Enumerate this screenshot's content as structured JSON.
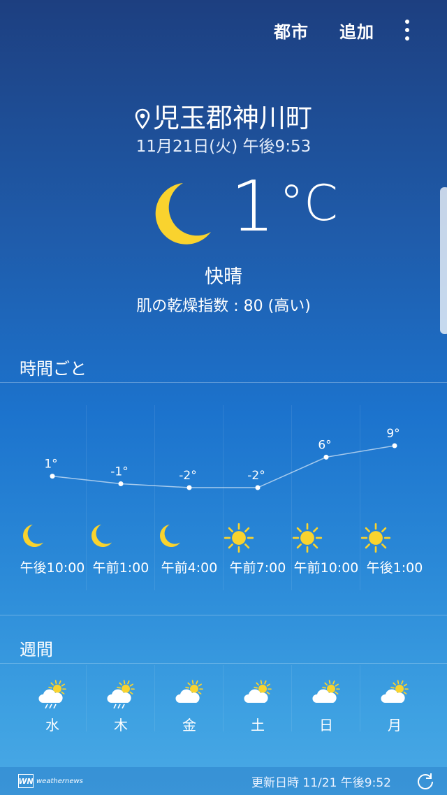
{
  "toolbar": {
    "city_label": "都市",
    "add_label": "追加"
  },
  "current": {
    "location": "児玉郡神川町",
    "datetime": "11月21日(火) 午後9:53",
    "temperature": "1",
    "unit": "°C",
    "condition": "快晴",
    "dryness": "肌の乾燥指数 : 80 (高い)",
    "icon": "moon-icon"
  },
  "hourly": {
    "title": "時間ごと",
    "items": [
      {
        "time": "午後10:00",
        "temp": "1°",
        "temp_value": 1,
        "icon": "moon-icon"
      },
      {
        "time": "午前1:00",
        "temp": "-1°",
        "temp_value": -1,
        "icon": "moon-icon"
      },
      {
        "time": "午前4:00",
        "temp": "-2°",
        "temp_value": -2,
        "icon": "moon-icon"
      },
      {
        "time": "午前7:00",
        "temp": "-2°",
        "temp_value": -2,
        "icon": "sun-icon"
      },
      {
        "time": "午前10:00",
        "temp": "6°",
        "temp_value": 6,
        "icon": "sun-icon"
      },
      {
        "time": "午後1:00",
        "temp": "9°",
        "temp_value": 9,
        "icon": "sun-icon"
      }
    ]
  },
  "weekly": {
    "title": "週間",
    "days": [
      {
        "label": "水",
        "icon": "sun-cloud-rain-icon"
      },
      {
        "label": "木",
        "icon": "sun-cloud-rain-icon"
      },
      {
        "label": "金",
        "icon": "sun-cloud-icon"
      },
      {
        "label": "土",
        "icon": "sun-cloud-icon"
      },
      {
        "label": "日",
        "icon": "sun-cloud-icon"
      },
      {
        "label": "月",
        "icon": "sun-cloud-icon"
      }
    ]
  },
  "footer": {
    "brand": "weathernews",
    "brand_badge": "WN",
    "updated": "更新日時 11/21  午後9:52"
  },
  "colors": {
    "moon": "#f9d32e",
    "sun": "#f9d32e",
    "cloud": "#ffffff"
  }
}
